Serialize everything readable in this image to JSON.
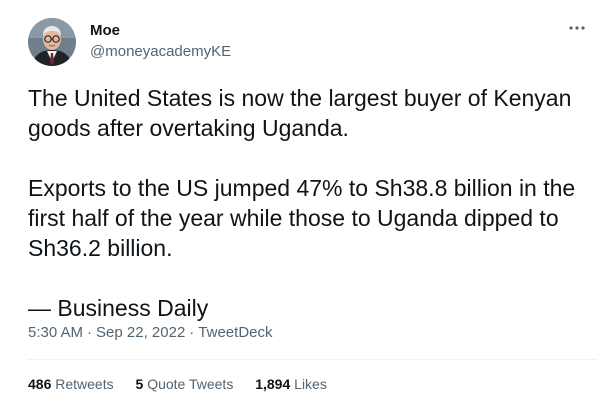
{
  "user": {
    "display_name": "Moe",
    "handle": "@moneyacademyKE",
    "avatar_icon": "avatar-portrait"
  },
  "menu": {
    "more_icon": "ellipsis-icon"
  },
  "tweet": {
    "paragraphs": [
      "The United States is now the largest buyer of Kenyan goods after overtaking Uganda.",
      "Exports to the US jumped 47% to Sh38.8 billion in the first half of the year while those to Uganda dipped to Sh36.2 billion.",
      "— Business Daily"
    ]
  },
  "meta": {
    "time": "5:30 AM",
    "separator": "·",
    "date": "Sep 22, 2022",
    "source": "TweetDeck"
  },
  "stats": {
    "retweets_count": "486",
    "retweets_label": "Retweets",
    "quotes_count": "5",
    "quotes_label": "Quote Tweets",
    "likes_count": "1,894",
    "likes_label": "Likes"
  },
  "colors": {
    "text_primary": "#0f1419",
    "text_secondary": "#536471",
    "divider": "#eff3f4"
  }
}
